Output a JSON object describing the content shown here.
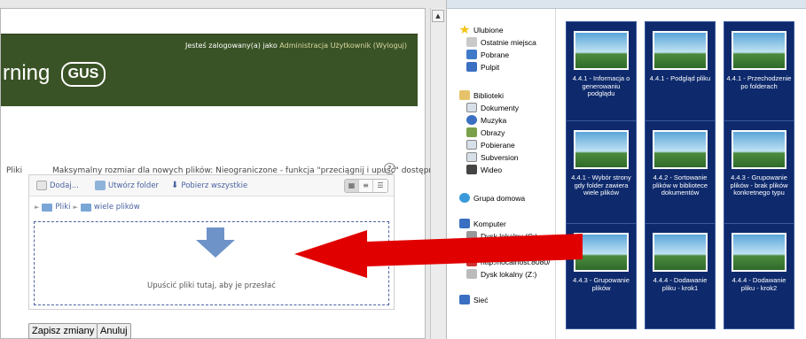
{
  "moodle": {
    "login_text": "Jesteś zalogowany(a) jako",
    "login_user": "Administracja Użytkownik",
    "logout": "(Wyloguj)",
    "brand_text": "rning",
    "logo_text": "GUS",
    "files_label": "Pliki",
    "max_size": "Maksymalny rozmiar dla nowych plików: Nieograniczone - funkcja \"przeciągnij i upuść\" dostępna",
    "help_icon": "?"
  },
  "filepicker": {
    "add_label": "Dodaj...",
    "create_folder_label": "Utwórz folder",
    "download_all_label": "Pobierz wszystkie",
    "path_root": "Pliki",
    "path_sep": "►",
    "path_folder": "wiele plików",
    "drop_text": "Upuścić pliki tutaj, aby je przesłać"
  },
  "buttons": {
    "save": "Zapisz zmiany",
    "cancel": "Anuluj"
  },
  "explorer_nav": {
    "favorites": "Ulubione",
    "recent": "Ostatnie miejsca",
    "downloads": "Pobrane",
    "desktop": "Pulpit",
    "libraries": "Biblioteki",
    "documents": "Dokumenty",
    "music": "Muzyka",
    "pictures": "Obrazy",
    "downloads2": "Pobierane",
    "subversion": "Subversion",
    "video": "Wideo",
    "homegroup": "Grupa domowa",
    "computer": "Komputer",
    "local_c": "Dysk lokalny (C:)",
    "localhost": "http://localhost:8080/",
    "local_z": "Dysk lokalny (Z:)",
    "network": "Sieć"
  },
  "thumbnails": [
    "4.4.1 - Informacja o generowaniu podglądu",
    "4.4.1 - Podgląd pliku",
    "4.4.1 - Przechodzenie po folderach",
    "4.4.1 - Wybór strony gdy folder zawiera wiele plików",
    "4.4.2 - Sortowanie plików w bibliotece dokumentów",
    "4.4.3 - Grupowanie plików - brak plików konkretnego typu",
    "4.4.3 - Grupowanie plików",
    "4.4.4 - Dodawanie pliku - krok1",
    "4.4.4 - Dodawanie pliku - krok2"
  ],
  "colors": {
    "header_green": "#3a5326",
    "selection_blue": "#0e2a6d",
    "arrow_red": "#e10000",
    "link_blue": "#4a62a0"
  }
}
